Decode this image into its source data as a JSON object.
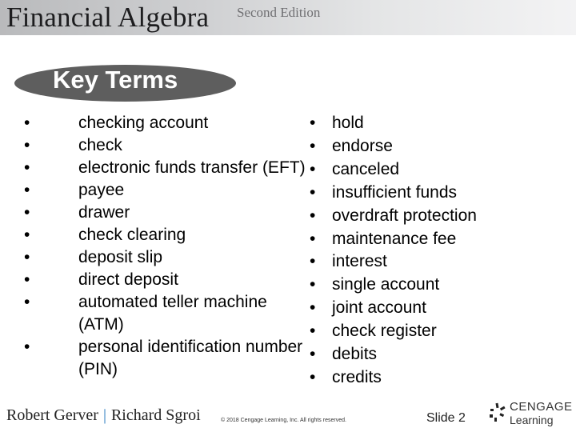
{
  "header": {
    "title": "Financial Algebra",
    "edition": "Second Edition"
  },
  "section": {
    "heading": "Key Terms"
  },
  "terms_left": [
    "checking account",
    "check",
    "electronic funds transfer (EFT)",
    "payee",
    "drawer",
    "check clearing",
    "deposit slip",
    "direct deposit",
    "automated teller machine (ATM)",
    "personal identification number (PIN)"
  ],
  "terms_right": [
    "hold",
    "endorse",
    "canceled",
    "insufficient funds",
    "overdraft protection",
    "maintenance fee",
    "interest",
    "single account",
    "joint account",
    "check register",
    "debits",
    "credits"
  ],
  "bullet_glyph": "•",
  "footer": {
    "author1": "Robert Gerver",
    "separator": "|",
    "author2": "Richard Sgroi",
    "copyright": "© 2018 Cengage Learning, Inc. All rights reserved.",
    "slide_number": "Slide 2",
    "logo_line1": "CENGAGE",
    "logo_line2": "Learning",
    "logo_icon": "cengage-logo-icon"
  },
  "colors": {
    "pill": "#5e5e5e",
    "separator_accent": "#2a7bbf"
  }
}
